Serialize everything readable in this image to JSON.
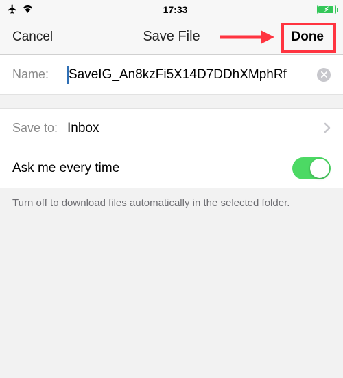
{
  "status": {
    "time": "17:33"
  },
  "nav": {
    "cancel": "Cancel",
    "title": "Save File",
    "done": "Done"
  },
  "name_row": {
    "label": "Name:",
    "value": "SaveIG_An8kzFi5X14D7DDhXMphRf"
  },
  "saveto_row": {
    "label": "Save to:",
    "value": "Inbox"
  },
  "toggle_row": {
    "label": "Ask me every time",
    "on": true
  },
  "footer": "Turn off to download files automatically in the selected folder."
}
